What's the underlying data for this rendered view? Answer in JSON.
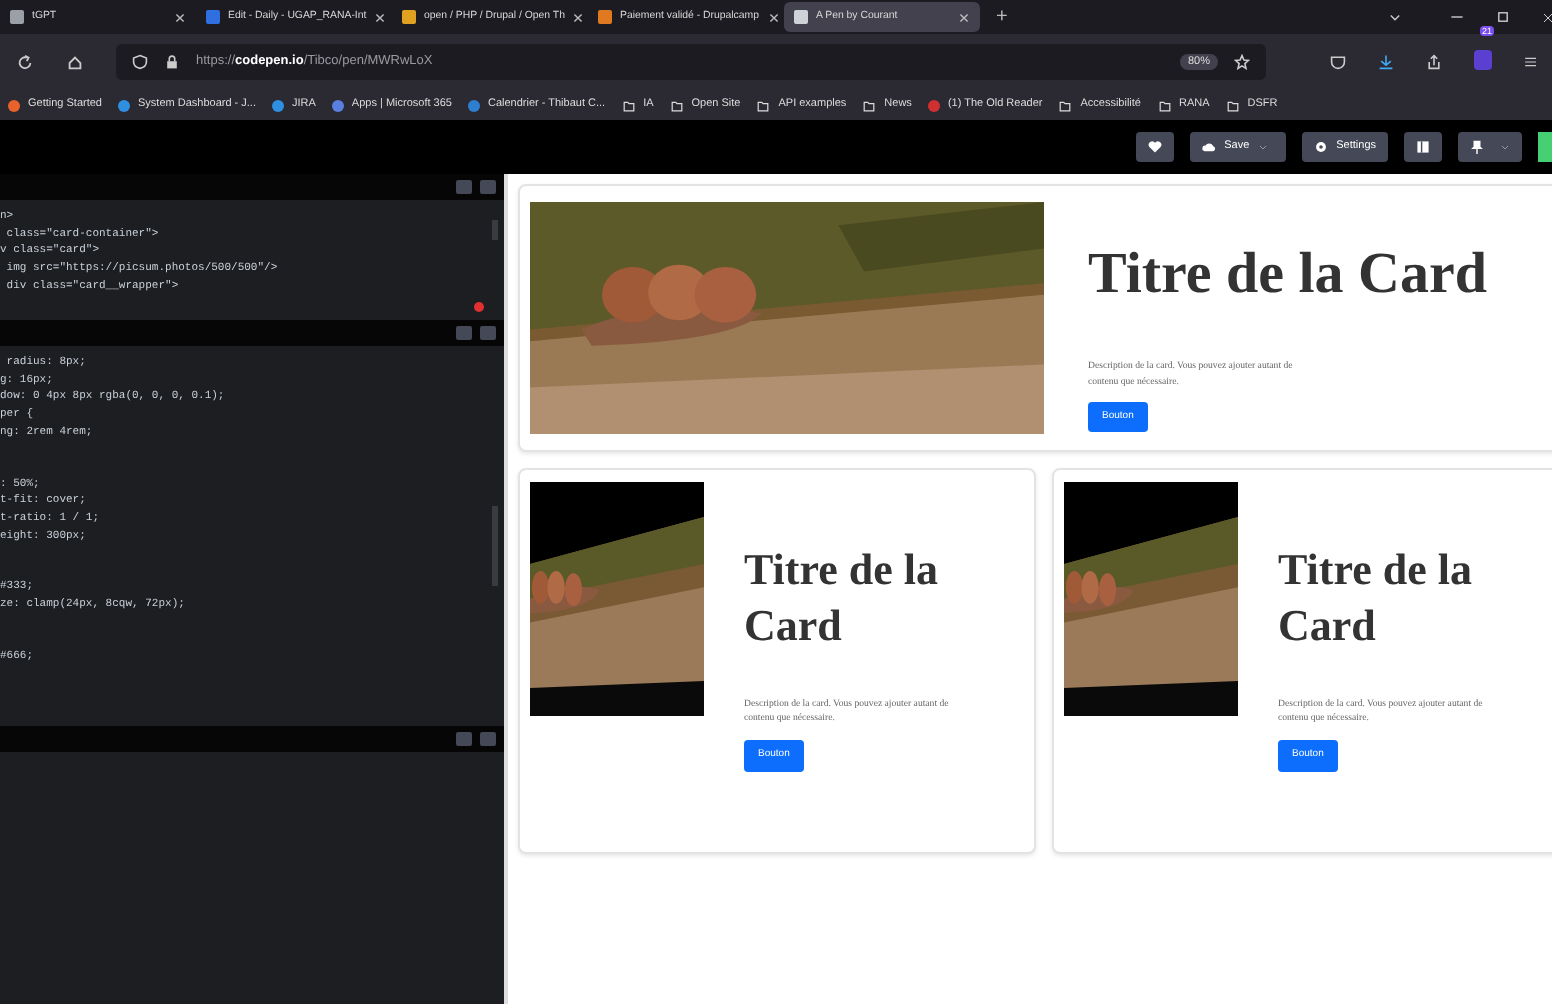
{
  "browser": {
    "tabs": [
      {
        "title": "tGPT",
        "selected": false,
        "color": "#9aa0a6"
      },
      {
        "title": "Edit - Daily - UGAP_RANA-Int",
        "selected": false,
        "color": "#2f6fe0"
      },
      {
        "title": "open / PHP / Drupal / Open Th",
        "selected": false,
        "color": "#e0a020"
      },
      {
        "title": "Paiement validé - Drupalcamp",
        "selected": false,
        "color": "#e07a20"
      },
      {
        "title": "A Pen by Courant",
        "selected": true,
        "color": "#cfd2d6"
      }
    ],
    "new_tab": "+",
    "url_host": "codepen.io",
    "url_prefix": "https://",
    "url_path": "/Tibco/pen/MWRwLoX",
    "zoom": "80%",
    "notification_count": "21",
    "bookmarks": [
      {
        "kind": "site",
        "label": "Getting Started",
        "color": "#e8632b"
      },
      {
        "kind": "site",
        "label": "System Dashboard - J...",
        "color": "#2f8fe0"
      },
      {
        "kind": "site",
        "label": "JIRA",
        "color": "#2f8fe0"
      },
      {
        "kind": "site",
        "label": "Apps | Microsoft 365",
        "color": "#5b7fe0"
      },
      {
        "kind": "site",
        "label": "Calendrier - Thibaut C...",
        "color": "#2f7fd0"
      },
      {
        "kind": "folder",
        "label": "IA"
      },
      {
        "kind": "folder",
        "label": "Open Site"
      },
      {
        "kind": "folder",
        "label": "API examples"
      },
      {
        "kind": "folder",
        "label": "News"
      },
      {
        "kind": "site",
        "label": "(1) The Old Reader",
        "color": "#d03030"
      },
      {
        "kind": "folder",
        "label": "Accessibilité"
      },
      {
        "kind": "folder",
        "label": "RANA"
      },
      {
        "kind": "folder",
        "label": "DSFR"
      }
    ]
  },
  "codepen": {
    "buttons": [
      {
        "kind": "heart"
      },
      {
        "kind": "save",
        "label": "Save"
      },
      {
        "kind": "settings",
        "label": "Settings"
      },
      {
        "kind": "layout"
      },
      {
        "kind": "pin"
      }
    ],
    "editors": [
      {
        "groups": [
          [
            "n>",
            " class=\"card-container\">",
            "v class=\"card\">",
            " img src=\"https://picsum.photos/500/500\"/>",
            " div class=\"card__wrapper\">"
          ]
        ],
        "error": true
      },
      {
        "groups": [
          [
            " radius: 8px;",
            "g: 16px;",
            "dow: 0 4px 8px rgba(0, 0, 0, 0.1);",
            "per {",
            "ng: 2rem 4rem;"
          ],
          [
            ": 50%;",
            "t-fit: cover;",
            "t-ratio: 1 / 1;",
            "eight: 300px;"
          ],
          [
            "#333;",
            "ze: clamp(24px, 8cqw, 72px);"
          ],
          [
            "#666;"
          ]
        ],
        "error": false
      },
      {
        "error": false
      }
    ]
  },
  "preview": {
    "cards": [
      {
        "kind": "wide",
        "title": "Titre de la Card",
        "description": "Description de la card. Vous pouvez ajouter autant de contenu que nécessaire.",
        "button": "Bouton"
      },
      {
        "kind": "tall",
        "title": "Titre de la Card",
        "description": "Description de la card. Vous pouvez ajouter autant de contenu que nécessaire.",
        "button": "Bouton"
      },
      {
        "kind": "tall",
        "title": "Titre de la Card",
        "description": "Description de la card. Vous pouvez ajouter autant de contenu que nécessaire.",
        "button": "Bouton"
      }
    ]
  }
}
